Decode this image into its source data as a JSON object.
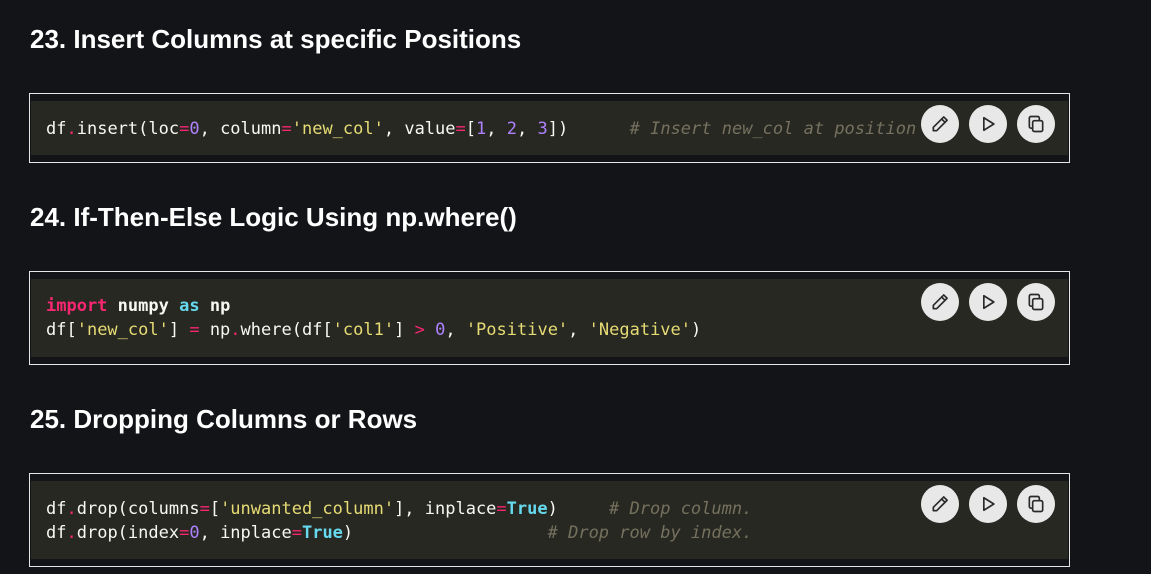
{
  "sections": [
    {
      "title": "23. Insert Columns at specific Positions",
      "code_lines": [
        [
          {
            "t": "df",
            "c": "plain"
          },
          {
            "t": ".",
            "c": "op"
          },
          {
            "t": "insert(loc",
            "c": "plain"
          },
          {
            "t": "=",
            "c": "op"
          },
          {
            "t": "0",
            "c": "num"
          },
          {
            "t": ", column",
            "c": "plain"
          },
          {
            "t": "=",
            "c": "op"
          },
          {
            "t": "'new_col'",
            "c": "str"
          },
          {
            "t": ", value",
            "c": "plain"
          },
          {
            "t": "=",
            "c": "op"
          },
          {
            "t": "[",
            "c": "plain"
          },
          {
            "t": "1",
            "c": "num"
          },
          {
            "t": ", ",
            "c": "plain"
          },
          {
            "t": "2",
            "c": "num"
          },
          {
            "t": ", ",
            "c": "plain"
          },
          {
            "t": "3",
            "c": "num"
          },
          {
            "t": "])      ",
            "c": "plain"
          },
          {
            "t": "# Insert new_col at posit",
            "c": "cmt"
          },
          {
            "t": "ion 0",
            "c": "cmt"
          }
        ]
      ]
    },
    {
      "title": "24. If-Then-Else Logic Using np.where()",
      "code_lines": [
        [
          {
            "t": "import",
            "c": "kw"
          },
          {
            "t": " ",
            "c": "plain"
          },
          {
            "t": "numpy",
            "c": "bold"
          },
          {
            "t": " ",
            "c": "plain"
          },
          {
            "t": "as",
            "c": "kw2"
          },
          {
            "t": " ",
            "c": "plain"
          },
          {
            "t": "np",
            "c": "bold"
          }
        ],
        [
          {
            "t": "df[",
            "c": "plain"
          },
          {
            "t": "'new_col'",
            "c": "str"
          },
          {
            "t": "] ",
            "c": "plain"
          },
          {
            "t": "=",
            "c": "op"
          },
          {
            "t": " np",
            "c": "plain"
          },
          {
            "t": ".",
            "c": "op"
          },
          {
            "t": "where(df[",
            "c": "plain"
          },
          {
            "t": "'col1'",
            "c": "str"
          },
          {
            "t": "] ",
            "c": "plain"
          },
          {
            "t": ">",
            "c": "op"
          },
          {
            "t": " ",
            "c": "plain"
          },
          {
            "t": "0",
            "c": "num"
          },
          {
            "t": ", ",
            "c": "plain"
          },
          {
            "t": "'Positive'",
            "c": "str"
          },
          {
            "t": ", ",
            "c": "plain"
          },
          {
            "t": "'Negative'",
            "c": "str"
          },
          {
            "t": ")",
            "c": "plain"
          }
        ]
      ]
    },
    {
      "title": "25. Dropping Columns or Rows",
      "code_lines": [
        [
          {
            "t": "df",
            "c": "plain"
          },
          {
            "t": ".",
            "c": "op"
          },
          {
            "t": "drop(columns",
            "c": "plain"
          },
          {
            "t": "=",
            "c": "op"
          },
          {
            "t": "[",
            "c": "plain"
          },
          {
            "t": "'unwanted_column'",
            "c": "str"
          },
          {
            "t": "], inplace",
            "c": "plain"
          },
          {
            "t": "=",
            "c": "op"
          },
          {
            "t": "True",
            "c": "bool"
          },
          {
            "t": ")     ",
            "c": "plain"
          },
          {
            "t": "# Drop column.",
            "c": "cmt"
          }
        ],
        [
          {
            "t": "df",
            "c": "plain"
          },
          {
            "t": ".",
            "c": "op"
          },
          {
            "t": "drop(index",
            "c": "plain"
          },
          {
            "t": "=",
            "c": "op"
          },
          {
            "t": "0",
            "c": "num"
          },
          {
            "t": ", inplace",
            "c": "plain"
          },
          {
            "t": "=",
            "c": "op"
          },
          {
            "t": "True",
            "c": "bool"
          },
          {
            "t": ")                   ",
            "c": "plain"
          },
          {
            "t": "# Drop row by index.",
            "c": "cmt"
          }
        ]
      ]
    }
  ],
  "actions": [
    {
      "name": "edit-button",
      "icon": "pencil-icon"
    },
    {
      "name": "run-button",
      "icon": "play-icon"
    },
    {
      "name": "copy-button",
      "icon": "copy-icon"
    }
  ],
  "colors": {
    "page_bg": "#131417",
    "code_bg": "#272822",
    "keyword": "#f92672",
    "string": "#e6db74",
    "number": "#ae81ff",
    "builtin": "#66d9ef",
    "comment": "#75715e"
  }
}
